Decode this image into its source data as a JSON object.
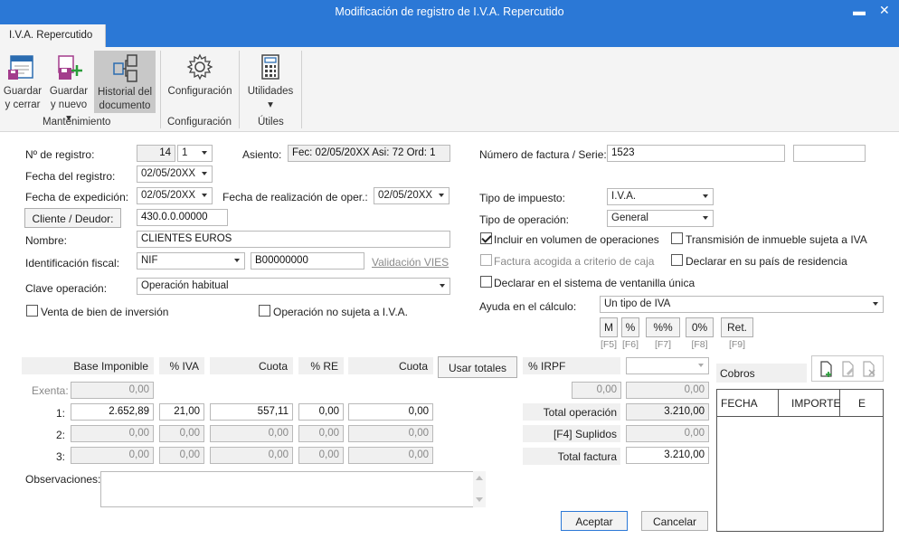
{
  "window": {
    "title": "Modificación de registro de I.V.A. Repercutido",
    "minimize": "▬",
    "close": "✕"
  },
  "tab": {
    "label": "I.V.A. Repercutido"
  },
  "ribbon": {
    "save_close": [
      "Guardar",
      "y cerrar"
    ],
    "save_new": [
      "Guardar",
      "y nuevo"
    ],
    "history": [
      "Historial del",
      "documento"
    ],
    "config": "Configuración",
    "utilities": "Utilidades",
    "groups": {
      "maintenance": "Mantenimiento",
      "config": "Configuración",
      "utils": "Útiles"
    }
  },
  "form": {
    "registro_label": "Nº de registro:",
    "registro_value": "14",
    "registro_serie": "1",
    "asiento_label": "Asiento:",
    "asiento_value": "Fec: 02/05/20XX Asi: 72 Ord: 1",
    "fecha_registro_label": "Fecha del registro:",
    "fecha_registro": "02/05/20XX",
    "fecha_expedicion_label": "Fecha de expedición:",
    "fecha_expedicion": "02/05/20XX",
    "fecha_realizacion_label": "Fecha de realización de oper.:",
    "fecha_realizacion": "02/05/20XX",
    "cliente_button": "Cliente / Deudor:",
    "cliente_cuenta": "430.0.0.00000",
    "nombre_label": "Nombre:",
    "nombre": "CLIENTES EUROS",
    "ident_label": "Identificación fiscal:",
    "ident_tipo": "NIF",
    "ident_valor": "B00000000",
    "validacion": "Validación VIES",
    "clave_label": "Clave operación:",
    "clave": "Operación habitual",
    "venta_bien": "Venta de bien de inversión",
    "no_sujeta": "Operación no sujeta a I.V.A.",
    "factura_label": "Número de factura / Serie:",
    "factura": "1523",
    "serie": "",
    "tipo_impuesto_label": "Tipo de impuesto:",
    "tipo_impuesto": "I.V.A.",
    "tipo_operacion_label": "Tipo de operación:",
    "tipo_operacion": "General",
    "incluir_volumen": "Incluir en volumen de operaciones",
    "transmision": "Transmisión de inmueble sujeta a IVA",
    "criterio_caja": "Factura acogida a criterio de caja",
    "declarar_pais": "Declarar en su país de residencia",
    "ventanilla": "Declarar en el sistema de ventanilla única",
    "ayuda_label": "Ayuda en el cálculo:",
    "ayuda": "Un tipo de IVA",
    "calc_buttons": [
      {
        "label": "M",
        "key": "[F5]"
      },
      {
        "label": "%",
        "key": "[F6]"
      },
      {
        "label": "%%",
        "key": "[F7]"
      },
      {
        "label": "0%",
        "key": "[F8]"
      },
      {
        "label": "Ret.",
        "key": "[F9]"
      }
    ]
  },
  "grid": {
    "headers": {
      "base": "Base Imponible",
      "iva": "% IVA",
      "cuota": "Cuota",
      "re": "% RE",
      "cuota_re": "Cuota",
      "usar_totales": "Usar totales",
      "irpf": "% IRPF"
    },
    "exenta_label": "Exenta:",
    "exenta": "0,00",
    "rows": [
      {
        "label": "1:",
        "base": "2.652,89",
        "iva": "21,00",
        "cuota": "557,11",
        "re": "0,00",
        "cuota_re": "0,00"
      },
      {
        "label": "2:",
        "base": "0,00",
        "iva": "0,00",
        "cuota": "0,00",
        "re": "0,00",
        "cuota_re": "0,00"
      },
      {
        "label": "3:",
        "base": "0,00",
        "iva": "0,00",
        "cuota": "0,00",
        "re": "0,00",
        "cuota_re": "0,00"
      }
    ],
    "irpf_pct": "0,00",
    "irpf_amount": "0,00",
    "total_operacion_label": "Total operación",
    "total_operacion": "3.210,00",
    "suplidos_label": "[F4] Suplidos",
    "suplidos": "0,00",
    "total_factura_label": "Total factura",
    "total_factura": "3.210,00"
  },
  "observaciones_label": "Observaciones:",
  "cobros": {
    "title": "Cobros",
    "columns": [
      "FECHA",
      "IMPORTE",
      "E"
    ]
  },
  "actions": {
    "accept": "Aceptar",
    "cancel": "Cancelar"
  }
}
